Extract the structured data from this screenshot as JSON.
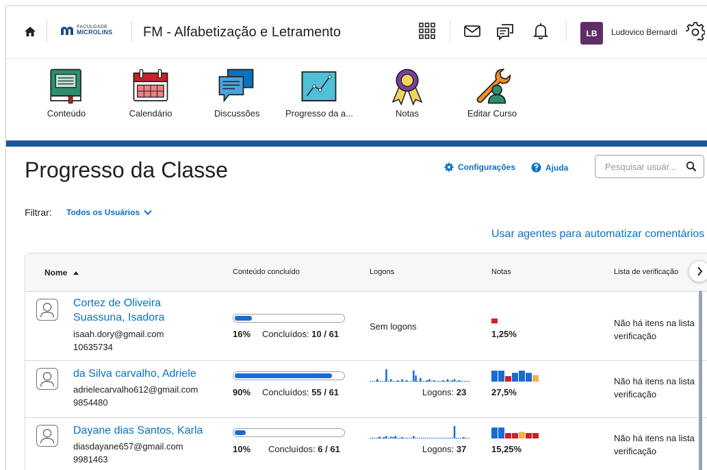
{
  "topbar": {
    "logo_small": "FACULDADE",
    "logo_name": "MICROLINS",
    "course_title": "FM - Alfabetização e Letramento",
    "user_initials": "LB",
    "user_name": "Ludovico Bernardi"
  },
  "nav": {
    "items": [
      {
        "label": "Conteúdo",
        "icon": "book-icon"
      },
      {
        "label": "Calendário",
        "icon": "calendar-icon"
      },
      {
        "label": "Discussões",
        "icon": "discussions-icon"
      },
      {
        "label": "Progresso da a...",
        "icon": "progress-chart-icon"
      },
      {
        "label": "Notas",
        "icon": "award-ribbon-icon"
      },
      {
        "label": "Editar Curso",
        "icon": "wrench-user-icon"
      }
    ]
  },
  "page": {
    "title": "Progresso da Classe",
    "settings_label": "Configurações",
    "help_label": "Ajuda",
    "search_placeholder": "Pesquisar usuár...",
    "filter_label": "Filtrar:",
    "filter_value": "Todos os Usuários",
    "agents_link": "Usar agentes para automatizar comentários"
  },
  "table": {
    "headers": {
      "name": "Nome",
      "content": "Conteúdo concluído",
      "logons": "Logons",
      "grades": "Notas",
      "checklist": "Lista de verificação"
    },
    "rows": [
      {
        "name_line1": "Cortez de Oliveira",
        "name_line2": "Suassuna, Isadora",
        "email": "isaah.dory@gmail.com",
        "id": "10635734",
        "progress_pct": "16%",
        "progress_fraction": 0.16,
        "completed_label": "Concluídos:",
        "completed_value": "10 / 61",
        "logons_text": "Sem logons",
        "logon_bars": [],
        "grade": "1,25%",
        "grade_bars": [
          {
            "h": 0.6,
            "color": "#cd2026"
          }
        ],
        "checklist_line1": "Não há itens na lista",
        "checklist_line2": "verificação"
      },
      {
        "name_line1": "da Silva carvalho, Adriele",
        "email": "adrielecarvalho612@gmail.com",
        "id": "9854480",
        "progress_pct": "90%",
        "progress_fraction": 0.9,
        "completed_label": "Concluídos:",
        "completed_value": "55 / 61",
        "logons_label": "Logons:",
        "logons_value": "23",
        "logon_bars": [
          0,
          0,
          0,
          0.2,
          0,
          0,
          0,
          1,
          0,
          0.2,
          0,
          0,
          0.1,
          0,
          0.2,
          0,
          0.1,
          0,
          0,
          0.9,
          0.5,
          0,
          0.3,
          0,
          0,
          0.1,
          0.2,
          0,
          0.1,
          0,
          0,
          0,
          0.1,
          0,
          0.2,
          0,
          0.1,
          0.2,
          0,
          0.1,
          0,
          0,
          0,
          0
        ],
        "grade": "27,5%",
        "grade_bars": [
          {
            "h": 1,
            "color": "#1c6ad3"
          },
          {
            "h": 1,
            "color": "#1c6ad3"
          },
          {
            "h": 0.5,
            "color": "#cd2026"
          },
          {
            "h": 0.8,
            "color": "#1c6ad3"
          },
          {
            "h": 1,
            "color": "#1c6ad3"
          },
          {
            "h": 0.8,
            "color": "#1c6ad3"
          },
          {
            "h": 0.6,
            "color": "#f4b04a"
          }
        ],
        "checklist_line1": "Não há itens na lista",
        "checklist_line2": "verificação"
      },
      {
        "name_line1": "Dayane dias Santos, Karla",
        "email": "diasdayane657@gmail.com",
        "id": "9981463",
        "progress_pct": "10%",
        "progress_fraction": 0.1,
        "completed_label": "Concluídos:",
        "completed_value": "6 / 61",
        "logons_label": "Logons:",
        "logons_value": "37",
        "logon_bars": [
          0,
          0,
          0,
          0,
          0.15,
          0,
          0.1,
          0.2,
          0,
          0.15,
          0.1,
          0.2,
          0,
          0,
          0.1,
          0,
          0,
          0,
          0,
          0.2,
          0,
          0,
          0,
          0,
          0,
          0,
          0,
          0,
          0,
          0,
          0,
          0,
          0,
          0,
          0,
          0,
          0,
          1,
          0,
          0,
          0,
          0.1,
          0,
          0
        ],
        "grade": "15,25%",
        "grade_bars": [
          {
            "h": 1,
            "color": "#1c6ad3"
          },
          {
            "h": 1,
            "color": "#1c6ad3"
          },
          {
            "h": 0.5,
            "color": "#cd2026"
          },
          {
            "h": 0.5,
            "color": "#cd2026"
          },
          {
            "h": 0.6,
            "color": "#f4b04a"
          },
          {
            "h": 0.5,
            "color": "#cd2026"
          },
          {
            "h": 0.5,
            "color": "#cd2026"
          }
        ],
        "checklist_line1": "Não há itens na lista",
        "checklist_line2": "verificação"
      }
    ]
  },
  "colors": {
    "accent": "#0a71c3",
    "band": "#1a5796",
    "progress": "#1c6ad3"
  }
}
